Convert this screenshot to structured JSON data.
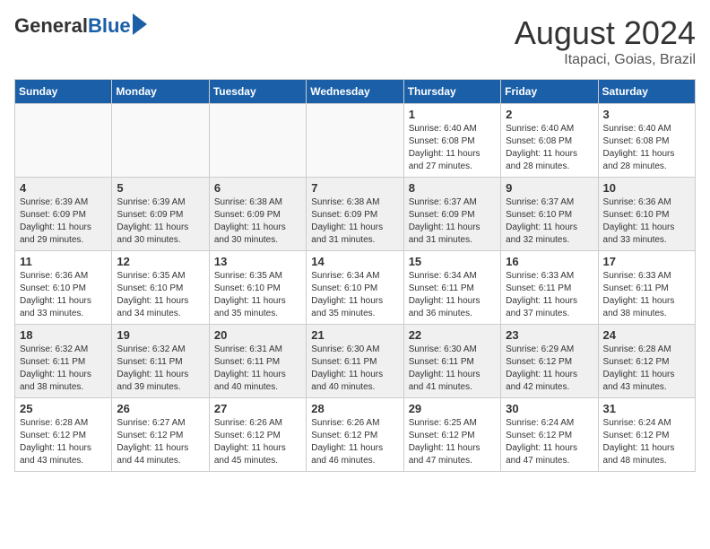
{
  "header": {
    "logo_general": "General",
    "logo_blue": "Blue",
    "month_year": "August 2024",
    "location": "Itapaci, Goias, Brazil"
  },
  "weekdays": [
    "Sunday",
    "Monday",
    "Tuesday",
    "Wednesday",
    "Thursday",
    "Friday",
    "Saturday"
  ],
  "weeks": [
    [
      {
        "day": "",
        "info": ""
      },
      {
        "day": "",
        "info": ""
      },
      {
        "day": "",
        "info": ""
      },
      {
        "day": "",
        "info": ""
      },
      {
        "day": "1",
        "info": "Sunrise: 6:40 AM\nSunset: 6:08 PM\nDaylight: 11 hours and 27 minutes."
      },
      {
        "day": "2",
        "info": "Sunrise: 6:40 AM\nSunset: 6:08 PM\nDaylight: 11 hours and 28 minutes."
      },
      {
        "day": "3",
        "info": "Sunrise: 6:40 AM\nSunset: 6:08 PM\nDaylight: 11 hours and 28 minutes."
      }
    ],
    [
      {
        "day": "4",
        "info": "Sunrise: 6:39 AM\nSunset: 6:09 PM\nDaylight: 11 hours and 29 minutes."
      },
      {
        "day": "5",
        "info": "Sunrise: 6:39 AM\nSunset: 6:09 PM\nDaylight: 11 hours and 30 minutes."
      },
      {
        "day": "6",
        "info": "Sunrise: 6:38 AM\nSunset: 6:09 PM\nDaylight: 11 hours and 30 minutes."
      },
      {
        "day": "7",
        "info": "Sunrise: 6:38 AM\nSunset: 6:09 PM\nDaylight: 11 hours and 31 minutes."
      },
      {
        "day": "8",
        "info": "Sunrise: 6:37 AM\nSunset: 6:09 PM\nDaylight: 11 hours and 31 minutes."
      },
      {
        "day": "9",
        "info": "Sunrise: 6:37 AM\nSunset: 6:10 PM\nDaylight: 11 hours and 32 minutes."
      },
      {
        "day": "10",
        "info": "Sunrise: 6:36 AM\nSunset: 6:10 PM\nDaylight: 11 hours and 33 minutes."
      }
    ],
    [
      {
        "day": "11",
        "info": "Sunrise: 6:36 AM\nSunset: 6:10 PM\nDaylight: 11 hours and 33 minutes."
      },
      {
        "day": "12",
        "info": "Sunrise: 6:35 AM\nSunset: 6:10 PM\nDaylight: 11 hours and 34 minutes."
      },
      {
        "day": "13",
        "info": "Sunrise: 6:35 AM\nSunset: 6:10 PM\nDaylight: 11 hours and 35 minutes."
      },
      {
        "day": "14",
        "info": "Sunrise: 6:34 AM\nSunset: 6:10 PM\nDaylight: 11 hours and 35 minutes."
      },
      {
        "day": "15",
        "info": "Sunrise: 6:34 AM\nSunset: 6:11 PM\nDaylight: 11 hours and 36 minutes."
      },
      {
        "day": "16",
        "info": "Sunrise: 6:33 AM\nSunset: 6:11 PM\nDaylight: 11 hours and 37 minutes."
      },
      {
        "day": "17",
        "info": "Sunrise: 6:33 AM\nSunset: 6:11 PM\nDaylight: 11 hours and 38 minutes."
      }
    ],
    [
      {
        "day": "18",
        "info": "Sunrise: 6:32 AM\nSunset: 6:11 PM\nDaylight: 11 hours and 38 minutes."
      },
      {
        "day": "19",
        "info": "Sunrise: 6:32 AM\nSunset: 6:11 PM\nDaylight: 11 hours and 39 minutes."
      },
      {
        "day": "20",
        "info": "Sunrise: 6:31 AM\nSunset: 6:11 PM\nDaylight: 11 hours and 40 minutes."
      },
      {
        "day": "21",
        "info": "Sunrise: 6:30 AM\nSunset: 6:11 PM\nDaylight: 11 hours and 40 minutes."
      },
      {
        "day": "22",
        "info": "Sunrise: 6:30 AM\nSunset: 6:11 PM\nDaylight: 11 hours and 41 minutes."
      },
      {
        "day": "23",
        "info": "Sunrise: 6:29 AM\nSunset: 6:12 PM\nDaylight: 11 hours and 42 minutes."
      },
      {
        "day": "24",
        "info": "Sunrise: 6:28 AM\nSunset: 6:12 PM\nDaylight: 11 hours and 43 minutes."
      }
    ],
    [
      {
        "day": "25",
        "info": "Sunrise: 6:28 AM\nSunset: 6:12 PM\nDaylight: 11 hours and 43 minutes."
      },
      {
        "day": "26",
        "info": "Sunrise: 6:27 AM\nSunset: 6:12 PM\nDaylight: 11 hours and 44 minutes."
      },
      {
        "day": "27",
        "info": "Sunrise: 6:26 AM\nSunset: 6:12 PM\nDaylight: 11 hours and 45 minutes."
      },
      {
        "day": "28",
        "info": "Sunrise: 6:26 AM\nSunset: 6:12 PM\nDaylight: 11 hours and 46 minutes."
      },
      {
        "day": "29",
        "info": "Sunrise: 6:25 AM\nSunset: 6:12 PM\nDaylight: 11 hours and 47 minutes."
      },
      {
        "day": "30",
        "info": "Sunrise: 6:24 AM\nSunset: 6:12 PM\nDaylight: 11 hours and 47 minutes."
      },
      {
        "day": "31",
        "info": "Sunrise: 6:24 AM\nSunset: 6:12 PM\nDaylight: 11 hours and 48 minutes."
      }
    ]
  ]
}
